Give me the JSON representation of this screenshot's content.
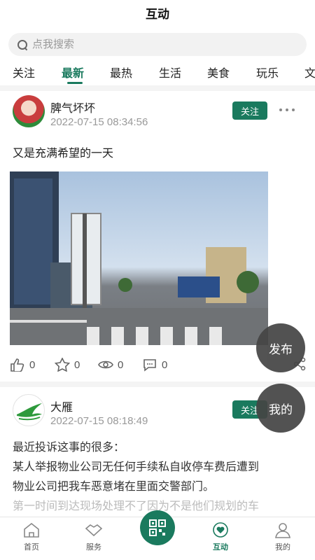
{
  "header": {
    "title": "互动"
  },
  "search": {
    "placeholder": "点我搜索"
  },
  "tabs": [
    "关注",
    "最新",
    "最热",
    "生活",
    "美食",
    "玩乐",
    "文"
  ],
  "posts": [
    {
      "username": "脾气坏坏",
      "time": "2022-07-15 08:34:56",
      "follow_label": "关注",
      "text": "又是充满希望的一天",
      "stats": {
        "likes": "0",
        "favorites": "0",
        "views": "0",
        "comments": "0"
      }
    },
    {
      "username": "大雁",
      "time": "2022-07-15 08:18:49",
      "follow_label": "关注",
      "lines": [
        "最近投诉这事的很多：",
        "某人举报物业公司无任何手续私自收停车费后遭到",
        "物业公司把我车恶意堵在里面交警部门。",
        "第一时间到达现场处理不了因为不是他们规划的车"
      ]
    }
  ],
  "fab": {
    "publish": "发布",
    "mine": "我的"
  },
  "bottom_nav": {
    "home": "首页",
    "service": "服务",
    "interact": "互动",
    "mine": "我的"
  },
  "colors": {
    "accent": "#1a7a5e",
    "fab": "#444444"
  }
}
